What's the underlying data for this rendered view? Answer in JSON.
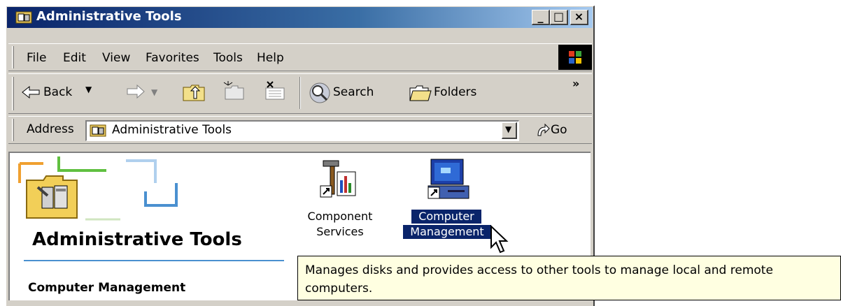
{
  "window": {
    "title": "Administrative Tools"
  },
  "title_buttons": {
    "minimize": "_",
    "maximize": "□",
    "close": "×"
  },
  "menu": [
    "File",
    "Edit",
    "View",
    "Favorites",
    "Tools",
    "Help"
  ],
  "toolbar": {
    "back": "Back",
    "search": "Search",
    "folders": "Folders",
    "more": "»"
  },
  "address": {
    "label": "Address",
    "value": "Administrative Tools",
    "go": "Go"
  },
  "content": {
    "header_title": "Administrative Tools",
    "selected_heading": "Computer Management",
    "items": [
      {
        "line1": "Component",
        "line2": "Services",
        "icon": "component-services-icon"
      },
      {
        "line1": "Computer",
        "line2": "Management",
        "icon": "computer-management-icon",
        "selected": true
      }
    ]
  },
  "tooltip": {
    "text": "Manages disks and provides access to other tools to manage local and remote computers."
  },
  "colors": {
    "titlebar_start": "#0a246a",
    "titlebar_end": "#a6caf0",
    "selection": "#0a246a",
    "tooltip_bg": "#ffffe1"
  }
}
